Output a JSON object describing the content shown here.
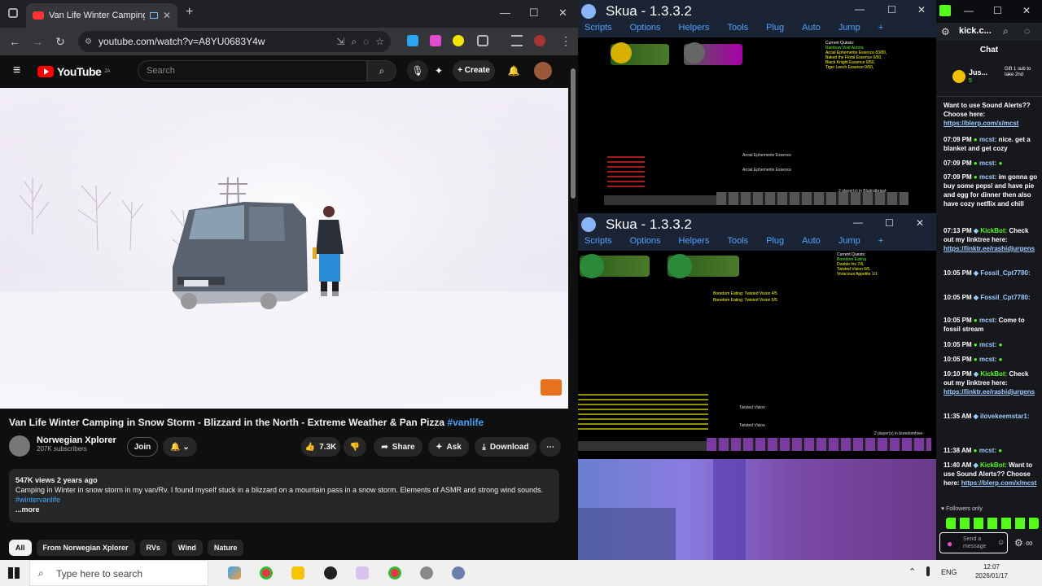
{
  "browser": {
    "tab_title": "Van Life Winter Camping in",
    "url": "youtube.com/watch?v=A8YU0683Y4w"
  },
  "youtube": {
    "logo_text": "YouTube",
    "logo_region": "ZA",
    "search_placeholder": "Search",
    "create_label": "Create",
    "video_title": "Van Life Winter Camping in Snow Storm - Blizzard in the North - Extreme Weather & Pan Pizza",
    "video_hashtag": "#vanlife",
    "channel_name": "Norwegian Xplorer",
    "subscribers": "207K subscribers",
    "join_label": "Join",
    "likes": "7.3K",
    "share_label": "Share",
    "ask_label": "Ask",
    "download_label": "Download",
    "views_meta": "547K views  2 years ago",
    "description": "Camping in Winter in snow storm in my van/Rv. I found myself stuck in a blizzard on a mountain pass in a snow storm. Elements of ASMR and strong wind sounds.",
    "desc_hashtag": "#wintervanlife",
    "more_label": "...more",
    "chips": [
      "All",
      "From Norwegian Xplorer",
      "RVs",
      "Wind",
      "Nature"
    ]
  },
  "skua_top": {
    "title": "Skua - 1.3.3.2",
    "menu": [
      "Scripts",
      "Options",
      "Helpers",
      "Tools",
      "Plug",
      "Auto",
      "Jump"
    ],
    "quests_title": "Current Quests:",
    "quests": [
      "Rainbow Void Aurora",
      "Arcial Ephemerite Essence 83/80,",
      "Baked the Floral Essence 0/50,",
      "Black Knight Essence 0/50,",
      "Tiger Leech Essence 0/50,"
    ],
    "loot": [
      "Arcial Ephemerite Essence",
      "Arcial Ephemerite Essence"
    ],
    "players": "2 player(s) in Bludrutbrawl-"
  },
  "skua_bottom": {
    "title": "Skua - 1.3.3.2",
    "menu": [
      "Scripts",
      "Options",
      "Helpers",
      "Tools",
      "Plug",
      "Auto",
      "Jump"
    ],
    "quests_title": "Current Quests:",
    "quests": [
      "Boredom Eating",
      "Double Iris 7/6,",
      "Twisted Vision 6/5,",
      "Voracious Appetite 1/1"
    ],
    "messages": [
      "Boredom Eating: Twisted Vision 4/5",
      "Boredom Eating: Twisted Vision 5/5"
    ],
    "loot": [
      "Twisted Vision",
      "Twisted Vision"
    ],
    "players": "2 player(s) in boredomhive-"
  },
  "kick": {
    "channel": "kick.c...",
    "chat_title": "Chat",
    "gift_user": "Jus...",
    "gift_count": "5",
    "gift_text": "Gift 1 sub to take 2nd",
    "messages": [
      {
        "ts": "",
        "user": "",
        "text": "Want to use Sound Alerts?? Choose here:",
        "link": "https://blerp.com/x/mcst"
      },
      {
        "ts": "07:09 PM",
        "user": "mcst:",
        "text": "nice. get a blanket and get cozy",
        "link": ""
      },
      {
        "ts": "07:09 PM",
        "user": "mcst:",
        "text": "",
        "link": ""
      },
      {
        "ts": "07:09 PM",
        "user": "mcst:",
        "text": "im gonna go buy some pepsi and have pie and egg for dinner then also have cozy netflix and chill",
        "link": ""
      },
      {
        "ts": "07:13 PM",
        "user": "KickBot:",
        "text": "Check out my linktree here:",
        "link": "https://linktr.ee/rashidjurgens"
      },
      {
        "ts": "10:05 PM",
        "user": "Fossil_Cpt7780:",
        "text": "",
        "link": ""
      },
      {
        "ts": "10:05 PM",
        "user": "Fossil_Cpt7780:",
        "text": "",
        "link": ""
      },
      {
        "ts": "10:05 PM",
        "user": "mcst:",
        "text": "Come to fossil stream",
        "link": ""
      },
      {
        "ts": "10:05 PM",
        "user": "mcst:",
        "text": "",
        "link": ""
      },
      {
        "ts": "10:05 PM",
        "user": "mcst:",
        "text": "",
        "link": ""
      },
      {
        "ts": "10:10 PM",
        "user": "KickBot:",
        "text": "Check out my linktree here:",
        "link": "https://linktr.ee/rashidjurgens"
      },
      {
        "ts": "11:35 AM",
        "user": "ilovekeemstar1:",
        "text": "",
        "link": ""
      },
      {
        "ts": "11:38 AM",
        "user": "mcst:",
        "text": "",
        "link": ""
      },
      {
        "ts": "11:40 AM",
        "user": "KickBot:",
        "text": "Want to use Sound Alerts?? Choose here:",
        "link": "https://blerp.com/x/mcst"
      }
    ],
    "followers_only": "Followers only",
    "send_placeholder": "Send a message"
  },
  "taskbar": {
    "search_placeholder": "Type here to search",
    "language": "ENG",
    "time": "12:07",
    "date": "2026/01/17"
  },
  "colors": {
    "kick_green": "#53fc18",
    "youtube_red": "#ff0000",
    "skua_menu_blue": "#4ea3ff"
  }
}
